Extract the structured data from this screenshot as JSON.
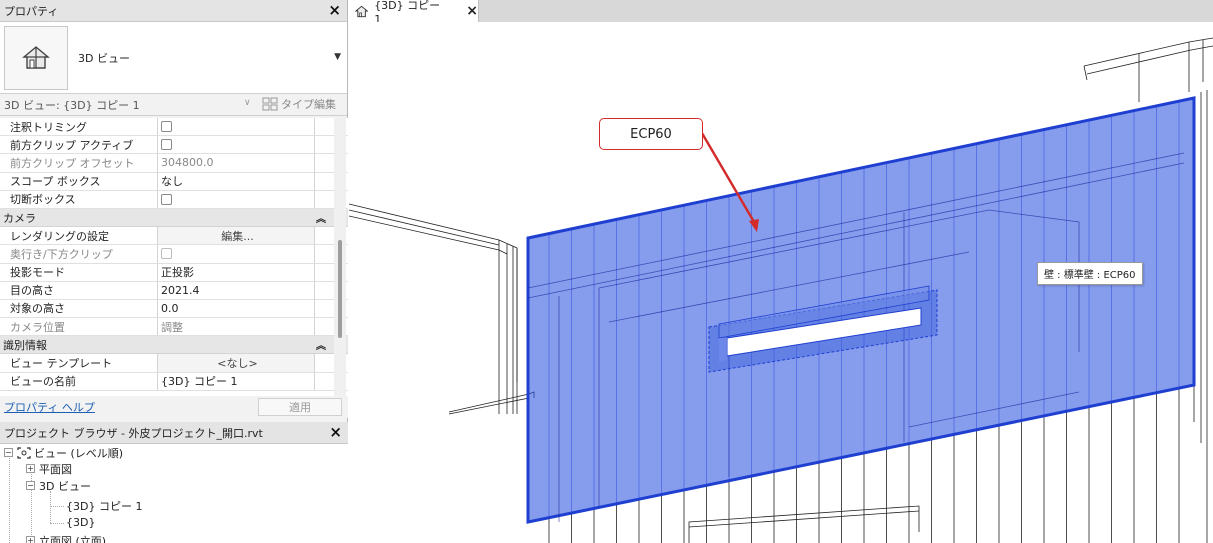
{
  "properties_panel": {
    "title": "プロパティ",
    "type_name": "3D ビュー",
    "instance_selector": "3D ビュー: {3D} コピー 1",
    "type_edit_label": "タイプ編集",
    "rows": [
      {
        "label": "注釈トリミング",
        "value": "",
        "kind": "checkbox",
        "grey": false
      },
      {
        "label": "前方クリップ アクティブ",
        "value": "",
        "kind": "checkbox",
        "grey": false
      },
      {
        "label": "前方クリップ オフセット",
        "value": "304800.0",
        "kind": "text",
        "grey": true
      },
      {
        "label": "スコープ ボックス",
        "value": "なし",
        "kind": "text",
        "grey": false
      },
      {
        "label": "切断ボックス",
        "value": "",
        "kind": "checkbox",
        "grey": false
      }
    ],
    "group_camera": "カメラ",
    "camera_rows": [
      {
        "label": "レンダリングの設定",
        "value": "編集...",
        "kind": "button",
        "grey": false
      },
      {
        "label": "奥行き/下方クリップ",
        "value": "",
        "kind": "checkbox",
        "grey": true
      },
      {
        "label": "投影モード",
        "value": "正投影",
        "kind": "text",
        "grey": false
      },
      {
        "label": "目の高さ",
        "value": "2021.4",
        "kind": "text",
        "grey": false
      },
      {
        "label": "対象の高さ",
        "value": "0.0",
        "kind": "text",
        "grey": false
      },
      {
        "label": "カメラ位置",
        "value": "調整",
        "kind": "text",
        "grey": true
      }
    ],
    "group_identity": "識別情報",
    "identity_rows": [
      {
        "label": "ビュー テンプレート",
        "value": "<なし>",
        "kind": "button",
        "grey": false
      },
      {
        "label": "ビューの名前",
        "value": "{3D} コピー 1",
        "kind": "text",
        "grey": false
      }
    ],
    "help_link": "プロパティ ヘルプ",
    "apply_label": "適用"
  },
  "project_browser": {
    "title": "プロジェクト ブラウザ - 外皮プロジェクト_開口.rvt",
    "root": "ビュー (レベル順)",
    "nodes": {
      "plan": "平面図",
      "view3d": "3D ビュー",
      "copy1": "{3D} コピー 1",
      "default3d": "{3D}",
      "elevation": "立面図 (立面)"
    }
  },
  "view_tab": {
    "label": "{3D} コピー 1"
  },
  "viewport": {
    "callout_text": "ECP60",
    "tooltip_text": "壁 : 標準壁 : ECP60",
    "wall_color": "#2f57e0",
    "callout_color": "#d42a2a"
  },
  "icons": {
    "close": "×",
    "chevron_up": "︽",
    "tree_collapse": "−",
    "tree_expand": "+",
    "dropdown": "▼",
    "dropdown_small": "∨"
  }
}
